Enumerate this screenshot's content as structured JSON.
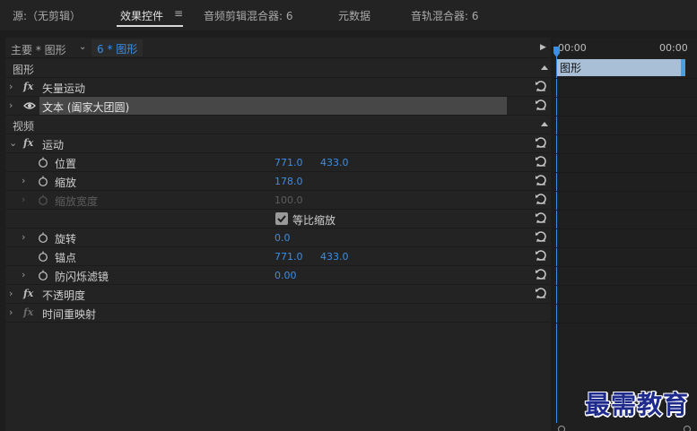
{
  "tabs": [
    {
      "label": "源:（无剪辑）"
    },
    {
      "label": "效果控件"
    },
    {
      "label": "音频剪辑混合器: 6"
    },
    {
      "label": "元数据"
    },
    {
      "label": "音轨混合器: 6"
    }
  ],
  "panel_menu_icon": "≡",
  "subheader": {
    "master": "主要 * 图形",
    "clip": "6 * 图形"
  },
  "sections": {
    "graphics": "图形",
    "video": "视频"
  },
  "effects": {
    "vector_motion": "矢量运动",
    "text_layer": "文本 (阖家大团圆)",
    "motion": "运动",
    "opacity": "不透明度",
    "time_remap": "时间重映射"
  },
  "properties": {
    "position": {
      "label": "位置",
      "x": "771.0",
      "y": "433.0"
    },
    "scale": {
      "label": "缩放",
      "value": "178.0"
    },
    "scale_width": {
      "label": "缩放宽度",
      "value": "100.0"
    },
    "uniform_scale": {
      "label": "等比缩放",
      "checked": true
    },
    "rotation": {
      "label": "旋转",
      "value": "0.0"
    },
    "anchor": {
      "label": "锚点",
      "x": "771.0",
      "y": "433.0"
    },
    "anti_flicker": {
      "label": "防闪烁滤镜",
      "value": "0.00"
    }
  },
  "timeline": {
    "time_start": "00:00",
    "time_end": "00:00",
    "clip_label": "图形"
  },
  "watermark": "最需教育",
  "colors": {
    "accent": "#3a8ee6",
    "clip": "#a9bfd6",
    "watermark": "#1e2a8c"
  }
}
